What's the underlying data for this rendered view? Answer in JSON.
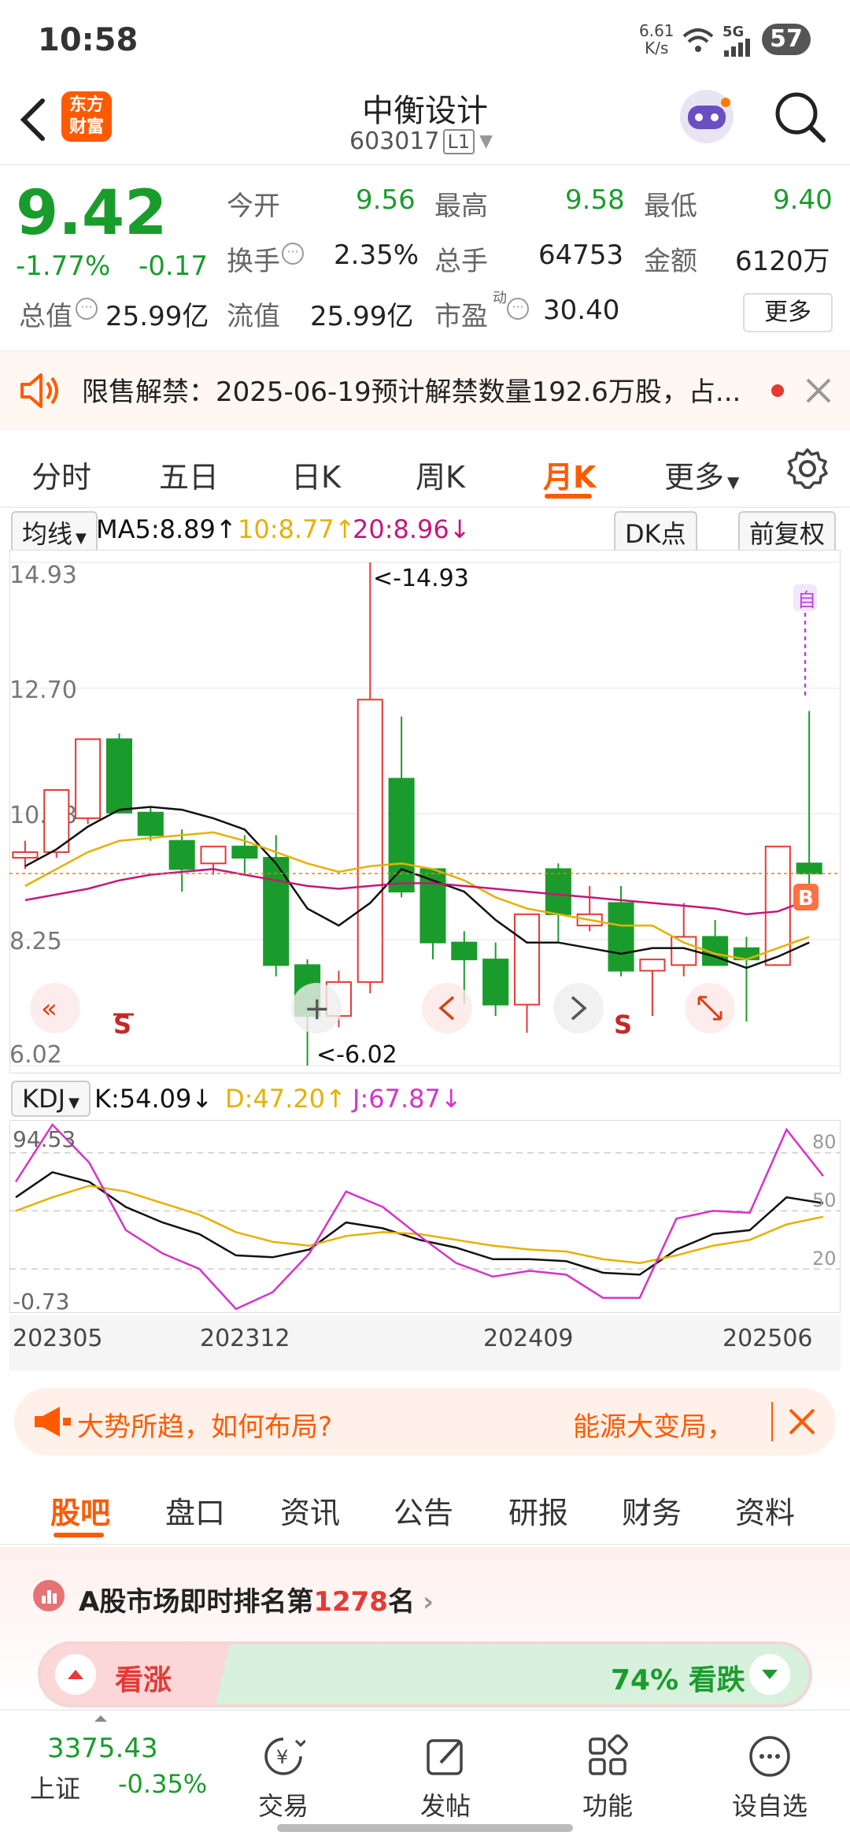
{
  "status_bar": {
    "time": "10:58",
    "net_speed_value": "6.61",
    "net_speed_unit": "K/s",
    "signal": "5G",
    "battery": "57"
  },
  "header": {
    "title": "中衡设计",
    "code": "603017",
    "level_badge": "L1"
  },
  "quote": {
    "price": "9.42",
    "change_pct": "-1.77%",
    "change": "-0.17",
    "open_label": "今开",
    "open": "9.56",
    "high_label": "最高",
    "high": "9.58",
    "low_label": "最低",
    "low": "9.40",
    "turnover_label": "换手",
    "turnover": "2.35%",
    "volume_label": "总手",
    "volume": "64753",
    "amount_label": "金额",
    "amount": "6120万",
    "total_cap_label": "总值",
    "total_cap": "25.99亿",
    "float_cap_label": "流值",
    "float_cap": "25.99亿",
    "pe_label": "市盈",
    "pe_sup": "动",
    "pe": "30.40",
    "more_button": "更多"
  },
  "notice": {
    "text": "限售解禁：2025-06-19预计解禁数量192.6万股，占..."
  },
  "chart_tabs": {
    "items": [
      "分时",
      "五日",
      "日K",
      "周K",
      "月K",
      "更多"
    ],
    "active": "月K"
  },
  "indicator_bar": {
    "selector": "均线",
    "ma5": "MA5:8.89",
    "ma10": "10:8.77",
    "ma20": "20:8.96",
    "dk_button": "DK点",
    "adjust_button": "前复权",
    "ma5_arrow": "↑",
    "ma10_arrow": "↑",
    "ma20_arrow": "↓"
  },
  "kdj_bar": {
    "selector": "KDJ",
    "k": "K:54.09",
    "d": "D:47.20",
    "j": "J:67.87",
    "k_arrow": "↓",
    "d_arrow": "↑",
    "j_arrow": "↓"
  },
  "chart_data": [
    {
      "type": "candlestick",
      "title": "月K",
      "y_tick_labels": [
        "14.93",
        "12.70",
        "10.48",
        "8.25",
        "6.02"
      ],
      "ylim": [
        6.02,
        14.93
      ],
      "max_annotation": "<-14.93",
      "min_annotation": "<-6.02",
      "self_marker": "自",
      "buy_marker": "B",
      "sell_marker": "S",
      "candles": [
        {
          "o": 9.7,
          "h": 10.0,
          "l": 9.5,
          "c": 9.8
        },
        {
          "o": 9.8,
          "h": 10.9,
          "l": 9.7,
          "c": 10.9
        },
        {
          "o": 10.4,
          "h": 11.5,
          "l": 10.3,
          "c": 11.8
        },
        {
          "o": 11.8,
          "h": 11.9,
          "l": 10.5,
          "c": 10.5
        },
        {
          "o": 10.5,
          "h": 10.6,
          "l": 10.0,
          "c": 10.1
        },
        {
          "o": 10.0,
          "h": 10.2,
          "l": 9.1,
          "c": 9.5
        },
        {
          "o": 9.6,
          "h": 9.9,
          "l": 9.4,
          "c": 9.9
        },
        {
          "o": 9.9,
          "h": 10.1,
          "l": 9.4,
          "c": 9.7
        },
        {
          "o": 9.7,
          "h": 10.1,
          "l": 7.6,
          "c": 7.8
        },
        {
          "o": 7.8,
          "h": 7.9,
          "l": 6.02,
          "c": 6.9
        },
        {
          "o": 6.9,
          "h": 7.7,
          "l": 6.7,
          "c": 7.5
        },
        {
          "o": 7.5,
          "h": 14.93,
          "l": 7.3,
          "c": 12.5
        },
        {
          "o": 11.1,
          "h": 12.2,
          "l": 9.0,
          "c": 9.1
        },
        {
          "o": 9.5,
          "h": 9.5,
          "l": 7.9,
          "c": 8.2
        },
        {
          "o": 8.2,
          "h": 8.4,
          "l": 7.1,
          "c": 7.9
        },
        {
          "o": 7.9,
          "h": 8.2,
          "l": 6.9,
          "c": 7.1
        },
        {
          "o": 7.1,
          "h": 8.7,
          "l": 6.6,
          "c": 8.7
        },
        {
          "o": 9.5,
          "h": 9.6,
          "l": 8.2,
          "c": 8.7
        },
        {
          "o": 8.5,
          "h": 9.2,
          "l": 8.4,
          "c": 8.7
        },
        {
          "o": 8.9,
          "h": 9.2,
          "l": 7.6,
          "c": 7.7
        },
        {
          "o": 7.7,
          "h": 7.8,
          "l": 6.9,
          "c": 7.9
        },
        {
          "o": 7.8,
          "h": 8.9,
          "l": 7.6,
          "c": 8.3
        },
        {
          "o": 8.3,
          "h": 8.6,
          "l": 7.9,
          "c": 7.8
        },
        {
          "o": 8.1,
          "h": 8.3,
          "l": 6.8,
          "c": 7.9
        },
        {
          "o": 7.8,
          "h": 9.9,
          "l": 7.8,
          "c": 9.9
        },
        {
          "o": 9.6,
          "h": 12.3,
          "l": 9.2,
          "c": 9.42
        }
      ],
      "ma_series": [
        {
          "name": "MA5",
          "color": "#111111",
          "values": [
            9.55,
            9.85,
            10.25,
            10.55,
            10.6,
            10.55,
            10.4,
            10.2,
            9.6,
            8.8,
            8.5,
            8.9,
            9.5,
            9.3,
            9.1,
            8.6,
            8.2,
            8.2,
            8.1,
            8.0,
            8.1,
            8.1,
            7.95,
            7.75,
            7.95,
            8.2
          ]
        },
        {
          "name": "MA10",
          "color": "#e6b100",
          "values": [
            9.2,
            9.5,
            9.8,
            10.0,
            10.05,
            10.1,
            10.15,
            10.0,
            9.8,
            9.6,
            9.45,
            9.55,
            9.6,
            9.5,
            9.3,
            9.0,
            8.8,
            8.7,
            8.6,
            8.5,
            8.5,
            8.2,
            8.0,
            7.9,
            8.1,
            8.3
          ]
        },
        {
          "name": "MA20",
          "color": "#c2187a",
          "values": [
            8.95,
            9.05,
            9.15,
            9.3,
            9.4,
            9.45,
            9.5,
            9.4,
            9.3,
            9.2,
            9.15,
            9.2,
            9.25,
            9.25,
            9.2,
            9.15,
            9.1,
            9.05,
            9.0,
            8.95,
            8.9,
            8.85,
            8.8,
            8.7,
            8.75,
            8.96
          ]
        }
      ]
    },
    {
      "type": "line",
      "title": "KDJ",
      "y_tick_labels_left": [
        "94.53",
        "-0.73"
      ],
      "y_tick_labels_right": [
        "80",
        "50",
        "20"
      ],
      "ylim": [
        -0.73,
        94.53
      ],
      "x_tick_labels": [
        "202305",
        "202312",
        "202409",
        "202506"
      ],
      "series": [
        {
          "name": "K",
          "color": "#111111",
          "values": [
            57,
            70,
            65,
            52,
            44,
            38,
            27,
            26,
            30,
            44,
            41,
            35,
            31,
            25,
            25,
            24,
            18,
            17,
            30,
            38,
            40,
            57,
            54
          ]
        },
        {
          "name": "D",
          "color": "#e6b100",
          "values": [
            50,
            57,
            63,
            60,
            54,
            48,
            39,
            34,
            32,
            37,
            39,
            38,
            35,
            32,
            30,
            29,
            25,
            23,
            27,
            32,
            35,
            43,
            47
          ]
        },
        {
          "name": "J",
          "color": "#d633c8",
          "values": [
            65,
            94.53,
            75,
            40,
            28,
            20,
            -0.73,
            8,
            28,
            60,
            52,
            37,
            23,
            16,
            19,
            17,
            5,
            5,
            46,
            50,
            49,
            92,
            68
          ]
        }
      ]
    }
  ],
  "chart_controls": {
    "zoom_out": "«",
    "zoom_in": "+"
  },
  "promo": {
    "text1": "大势所趋，如何布局?",
    "text2": "能源大变局，"
  },
  "bottom_tabs": {
    "items": [
      "股吧",
      "盘口",
      "资讯",
      "公告",
      "研报",
      "财务",
      "资料"
    ],
    "active": "股吧"
  },
  "rank": {
    "prefix": "A股市场即时排名第",
    "number": "1278",
    "suffix": "名",
    "bull": "看涨",
    "bear": "74% 看跌"
  },
  "bottom_nav": {
    "index_value": "3375.43",
    "index_name": "上证",
    "index_change": "-0.35%",
    "items": [
      "交易",
      "发帖",
      "功能",
      "设自选"
    ]
  },
  "colors": {
    "up": "#e53935",
    "down": "#1a9c2c",
    "accent": "#ff5a00"
  }
}
